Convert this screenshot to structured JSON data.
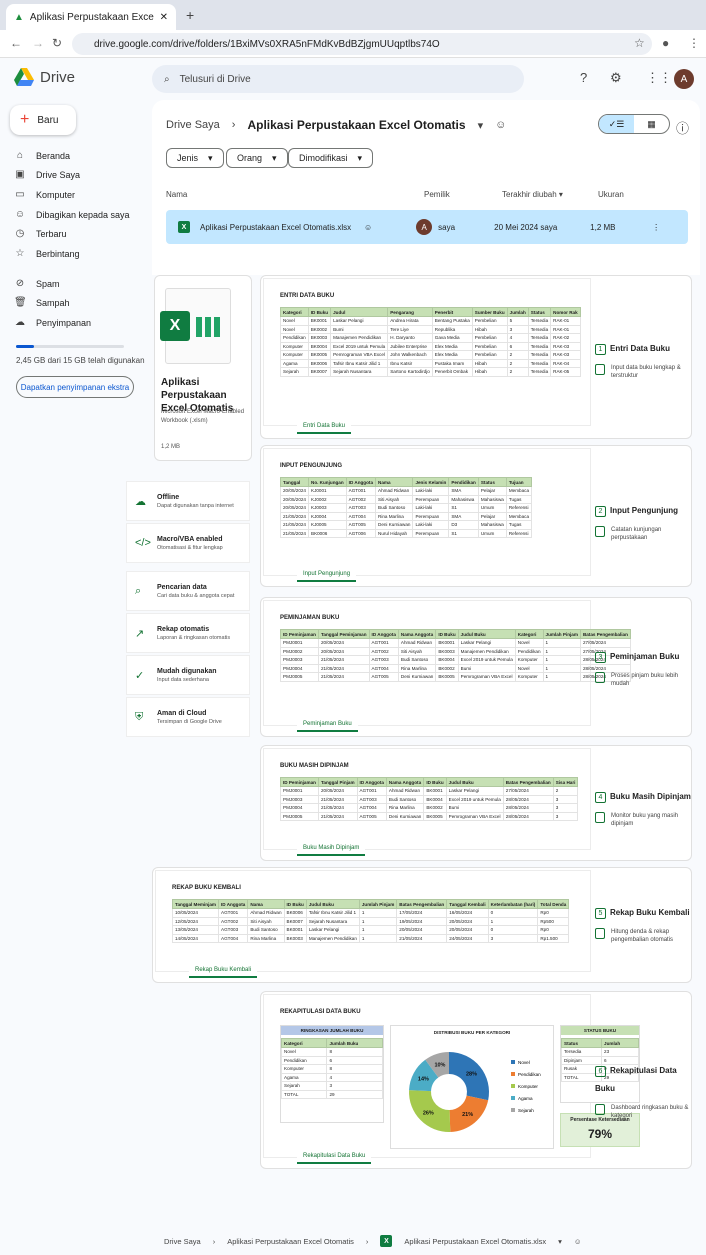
{
  "browser": {
    "tab_title": "Aplikasi Perpustakaan Excel Otom",
    "url": "drive.google.com/drive/folders/1BxiMVs0XRA5nFMdKvBdBZjgmUUqptlbs74O"
  },
  "drive": {
    "logo": "Drive",
    "search_placeholder": "Telusuri di Drive",
    "avatar": "A",
    "new_button": "Baru",
    "sidebar": [
      "Beranda",
      "Drive Saya",
      "Komputer",
      "Dibagikan kepada saya",
      "Terbaru",
      "Berbintang",
      "Spam",
      "Sampah",
      "Penyimpanan"
    ],
    "storage_text": "2,45 GB dari 15 GB telah digunakan",
    "storage_fraction": 0.163,
    "storage_button": "Dapatkan penyimpanan ekstra"
  },
  "header": {
    "crumb_root": "Drive Saya",
    "crumb_folder": "Aplikasi Perpustakaan Excel Otomatis"
  },
  "filters": [
    "Jenis",
    "Orang",
    "Dimodifikasi"
  ],
  "columns": {
    "name": "Nama",
    "owner": "Pemilik",
    "modified": "Terakhir diubah",
    "size": "Ukuran"
  },
  "file": {
    "name": "Aplikasi Perpustakaan Excel Otomatis.xlsx",
    "owner_avatar": "A",
    "owner": "saya",
    "modified": "20 Mei 2024 saya",
    "size": "1,2 MB"
  },
  "card": {
    "title": "Aplikasi Perpustakaan Excel Otomatis",
    "type": "Microsoft Excel Macro-Enabled Workbook (.xlsm)",
    "size": "1,2 MB"
  },
  "features": [
    {
      "title": "Offline",
      "desc": "Dapat digunakan tanpa internet",
      "icon": "☁"
    },
    {
      "title": "Macro/VBA enabled",
      "desc": "Otomatisasi & fitur lengkap",
      "icon": "</>"
    },
    {
      "title": "Pencarian data",
      "desc": "Cari data buku & anggota cepat",
      "icon": "⌕"
    },
    {
      "title": "Rekap otomatis",
      "desc": "Laporan & ringkasan otomatis",
      "icon": "↗"
    },
    {
      "title": "Mudah digunakan",
      "desc": "Input data sederhana",
      "icon": "✓"
    },
    {
      "title": "Aman di Cloud",
      "desc": "Tersimpan di Google Drive",
      "icon": "⛨"
    }
  ],
  "sheets": [
    {
      "title": "ENTRI DATA BUKU",
      "tab": "Entri Data Buku",
      "step": "1",
      "step_name": "Entri Data Buku",
      "step_desc": "Input data buku lengkap & terstruktur",
      "headers": [
        "Kategori",
        "ID Buku",
        "Judul",
        "Pengarang",
        "Penerbit",
        "Sumber Buku",
        "Jumlah",
        "Status",
        "Nomor Rak"
      ],
      "rows": [
        [
          "Novel",
          "BK0001",
          "Laskar Pelangi",
          "Andrea Hirata",
          "Bentang Pustaka",
          "Pembelian",
          "5",
          "Tersedia",
          "RAK-01"
        ],
        [
          "Novel",
          "BK0002",
          "Bumi",
          "Tere Liye",
          "Republika",
          "Hibah",
          "3",
          "Tersedia",
          "RAK-01"
        ],
        [
          "Pendidikan",
          "BK0003",
          "Manajemen Pendidikan",
          "H. Daryanto",
          "Gava Media",
          "Pembelian",
          "4",
          "Tersedia",
          "RAK-02"
        ],
        [
          "Komputer",
          "BK0004",
          "Excel 2019 untuk Pemula",
          "Jubilee Enterprise",
          "Elex Media",
          "Pembelian",
          "6",
          "Tersedia",
          "RAK-03"
        ],
        [
          "Komputer",
          "BK0005",
          "Pemrograman VBA Excel",
          "John Walkenbach",
          "Elex Media",
          "Pembelian",
          "2",
          "Tersedia",
          "RAK-03"
        ],
        [
          "Agama",
          "BK0006",
          "Tafsir Ibnu Katsir Jilid 1",
          "Ibnu Katsir",
          "Pustaka Imam",
          "Hibah",
          "2",
          "Tersedia",
          "RAK-04"
        ],
        [
          "Sejarah",
          "BK0007",
          "Sejarah Nusantara",
          "Sartono Kartodirdjo",
          "Penerbit Ombak",
          "Hibah",
          "2",
          "Tersedia",
          "RAK-05"
        ]
      ]
    },
    {
      "title": "INPUT PENGUNJUNG",
      "tab": "Input Pengunjung",
      "step": "2",
      "step_name": "Input Pengunjung",
      "step_desc": "Catatan kunjungan perpustakaan",
      "headers": [
        "Tanggal",
        "No. Kunjungan",
        "ID Anggota",
        "Nama",
        "Jenis Kelamin",
        "Pendidikan",
        "Status",
        "Tujuan"
      ],
      "rows": [
        [
          "20/05/2024",
          "KJ0001",
          "AGT001",
          "Ahmad Ridwan",
          "Laki-laki",
          "SMA",
          "Pelajar",
          "Membaca"
        ],
        [
          "20/05/2024",
          "KJ0002",
          "AGT002",
          "Siti Aisyah",
          "Perempuan",
          "Mahasiswa",
          "Mahasiswa",
          "Tugas"
        ],
        [
          "20/05/2024",
          "KJ0003",
          "AGT003",
          "Budi Santoso",
          "Laki-laki",
          "S1",
          "Umum",
          "Referensi"
        ],
        [
          "21/05/2024",
          "KJ0004",
          "AGT004",
          "Rina Marlina",
          "Perempuan",
          "SMA",
          "Pelajar",
          "Membaca"
        ],
        [
          "21/05/2024",
          "KJ0005",
          "AGT005",
          "Deni Kurniawan",
          "Laki-laki",
          "D3",
          "Mahasiswa",
          "Tugas"
        ],
        [
          "21/05/2024",
          "BK0006",
          "AGT006",
          "Nurul Hidayah",
          "Perempuan",
          "S1",
          "Umum",
          "Referensi"
        ]
      ]
    },
    {
      "title": "PEMINJAMAN BUKU",
      "tab": "Peminjaman Buku",
      "step": "3",
      "step_name": "Peminjaman Buku",
      "step_desc": "Proses pinjam buku lebih mudah",
      "headers": [
        "ID Peminjaman",
        "Tanggal Peminjaman",
        "ID Anggota",
        "Nama Anggota",
        "ID Buku",
        "Judul Buku",
        "Kategori",
        "Jumlah Pinjam",
        "Batas Pengembalian"
      ],
      "rows": [
        [
          "PMJ0001",
          "20/05/2024",
          "AGT001",
          "Ahmad Ridwan",
          "BK0001",
          "Laskar Pelangi",
          "Novel",
          "1",
          "27/05/2024"
        ],
        [
          "PMJ0002",
          "20/05/2024",
          "AGT002",
          "Siti Aisyah",
          "BK0003",
          "Manajemen Pendidikan",
          "Pendidikan",
          "1",
          "27/05/2024"
        ],
        [
          "PMJ0003",
          "21/05/2024",
          "AGT003",
          "Budi Santoso",
          "BK0004",
          "Excel 2019 untuk Pemula",
          "Komputer",
          "1",
          "28/05/2024"
        ],
        [
          "PMJ0004",
          "21/05/2024",
          "AGT004",
          "Rina Marlina",
          "BK0002",
          "Bumi",
          "Novel",
          "1",
          "28/05/2024"
        ],
        [
          "PMJ0005",
          "21/05/2024",
          "AGT005",
          "Deni Kurniawan",
          "BK0005",
          "Pemrograman VBA Excel",
          "Komputer",
          "1",
          "28/05/2024"
        ]
      ]
    },
    {
      "title": "BUKU MASIH DIPINJAM",
      "tab": "Buku Masih Dipinjam",
      "step": "4",
      "step_name": "Buku Masih Dipinjam",
      "step_desc": "Monitor buku yang masih dipinjam",
      "headers": [
        "ID Peminjaman",
        "Tanggal Pinjam",
        "ID Anggota",
        "Nama Anggota",
        "ID Buku",
        "Judul Buku",
        "Batas Pengembalian",
        "Sisa Hari"
      ],
      "rows": [
        [
          "PMJ0001",
          "20/05/2024",
          "AGT001",
          "Ahmad Ridwan",
          "BK0001",
          "Laskar Pelangi",
          "27/05/2024",
          "2"
        ],
        [
          "PMJ0003",
          "21/05/2024",
          "AGT003",
          "Budi Santoso",
          "BK0004",
          "Excel 2019 untuk Pemula",
          "28/05/2024",
          "3"
        ],
        [
          "PMJ0004",
          "21/05/2024",
          "AGT004",
          "Rina Marlina",
          "BK0002",
          "Bumi",
          "28/05/2024",
          "3"
        ],
        [
          "PMJ0005",
          "21/05/2024",
          "AGT005",
          "Deni Kurniawan",
          "BK0005",
          "Pemrograman VBA Excel",
          "28/05/2024",
          "3"
        ]
      ]
    },
    {
      "title": "REKAP BUKU KEMBALI",
      "tab": "Rekap Buku Kembali",
      "step": "5",
      "step_name": "Rekap Buku Kembali",
      "step_desc": "Hitung denda & rekap pengembalian otomatis",
      "headers": [
        "Tanggal Meminjam",
        "ID Anggota",
        "Nama",
        "ID Buku",
        "Judul Buku",
        "Jumlah Pinjam",
        "Batas Pengembalian",
        "Tanggal Kembali",
        "Keterlambatan (hari)",
        "Total Denda"
      ],
      "rows": [
        [
          "10/05/2024",
          "AGT001",
          "Ahmad Ridwan",
          "BK0006",
          "Tafsir Ibnu Katsir Jilid 1",
          "1",
          "17/05/2024",
          "16/05/2024",
          "0",
          "Rp0"
        ],
        [
          "12/05/2024",
          "AGT002",
          "Siti Aisyah",
          "BK0007",
          "Sejarah Nusantara",
          "1",
          "19/05/2024",
          "20/05/2024",
          "1",
          "Rp500"
        ],
        [
          "13/05/2024",
          "AGT003",
          "Budi Santoso",
          "BK0001",
          "Laskar Pelangi",
          "1",
          "20/05/2024",
          "20/05/2024",
          "0",
          "Rp0"
        ],
        [
          "14/05/2024",
          "AGT004",
          "Rina Marlina",
          "BK0003",
          "Manajemen Pendidikan",
          "1",
          "21/05/2024",
          "24/05/2024",
          "3",
          "Rp1.500"
        ]
      ]
    }
  ],
  "dashboard": {
    "title": "REKAPITULASI DATA BUKU",
    "tab": "Rekapitulasi Data Buku",
    "step": "6",
    "step_name": "Rekapitulasi Data Buku",
    "step_desc": "Dashboard ringkasan buku & kategori",
    "summary_title": "RINGKASAN JUMLAH BUKU",
    "summary_headers": [
      "Kategori",
      "Jumlah Buku"
    ],
    "summary_rows": [
      [
        "Novel",
        "8"
      ],
      [
        "Pendidikan",
        "6"
      ],
      [
        "Komputer",
        "8"
      ],
      [
        "Agama",
        "4"
      ],
      [
        "Sejarah",
        "3"
      ],
      [
        "TOTAL",
        "29"
      ]
    ],
    "status_title": "STATUS BUKU",
    "status_headers": [
      "Status",
      "Jumlah"
    ],
    "status_rows": [
      [
        "Tersedia",
        "23"
      ],
      [
        "Dipinjam",
        "6"
      ],
      [
        "Rusak",
        "0"
      ],
      [
        "TOTAL",
        "29"
      ]
    ],
    "kpi_label": "Persentase Ketersediaan",
    "kpi_value": "79%"
  },
  "chart_data": {
    "type": "pie",
    "title": "DISTRIBUSI BUKU PER KATEGORI",
    "categories": [
      "Novel",
      "Pendidikan",
      "Komputer",
      "Agama",
      "Sejarah"
    ],
    "values": [
      28,
      21,
      26,
      14,
      10
    ],
    "labels": [
      "28%",
      "21%",
      "26%",
      "14%",
      "10%"
    ],
    "colors": [
      "#2e75b6",
      "#ed7d31",
      "#a5c94d",
      "#4bacc6",
      "#a6a6a6"
    ],
    "legend": "right"
  },
  "footer": {
    "root": "Drive Saya",
    "folder": "Aplikasi Perpustakaan Excel Otomatis",
    "file": "Aplikasi Perpustakaan Excel Otomatis.xlsx"
  }
}
